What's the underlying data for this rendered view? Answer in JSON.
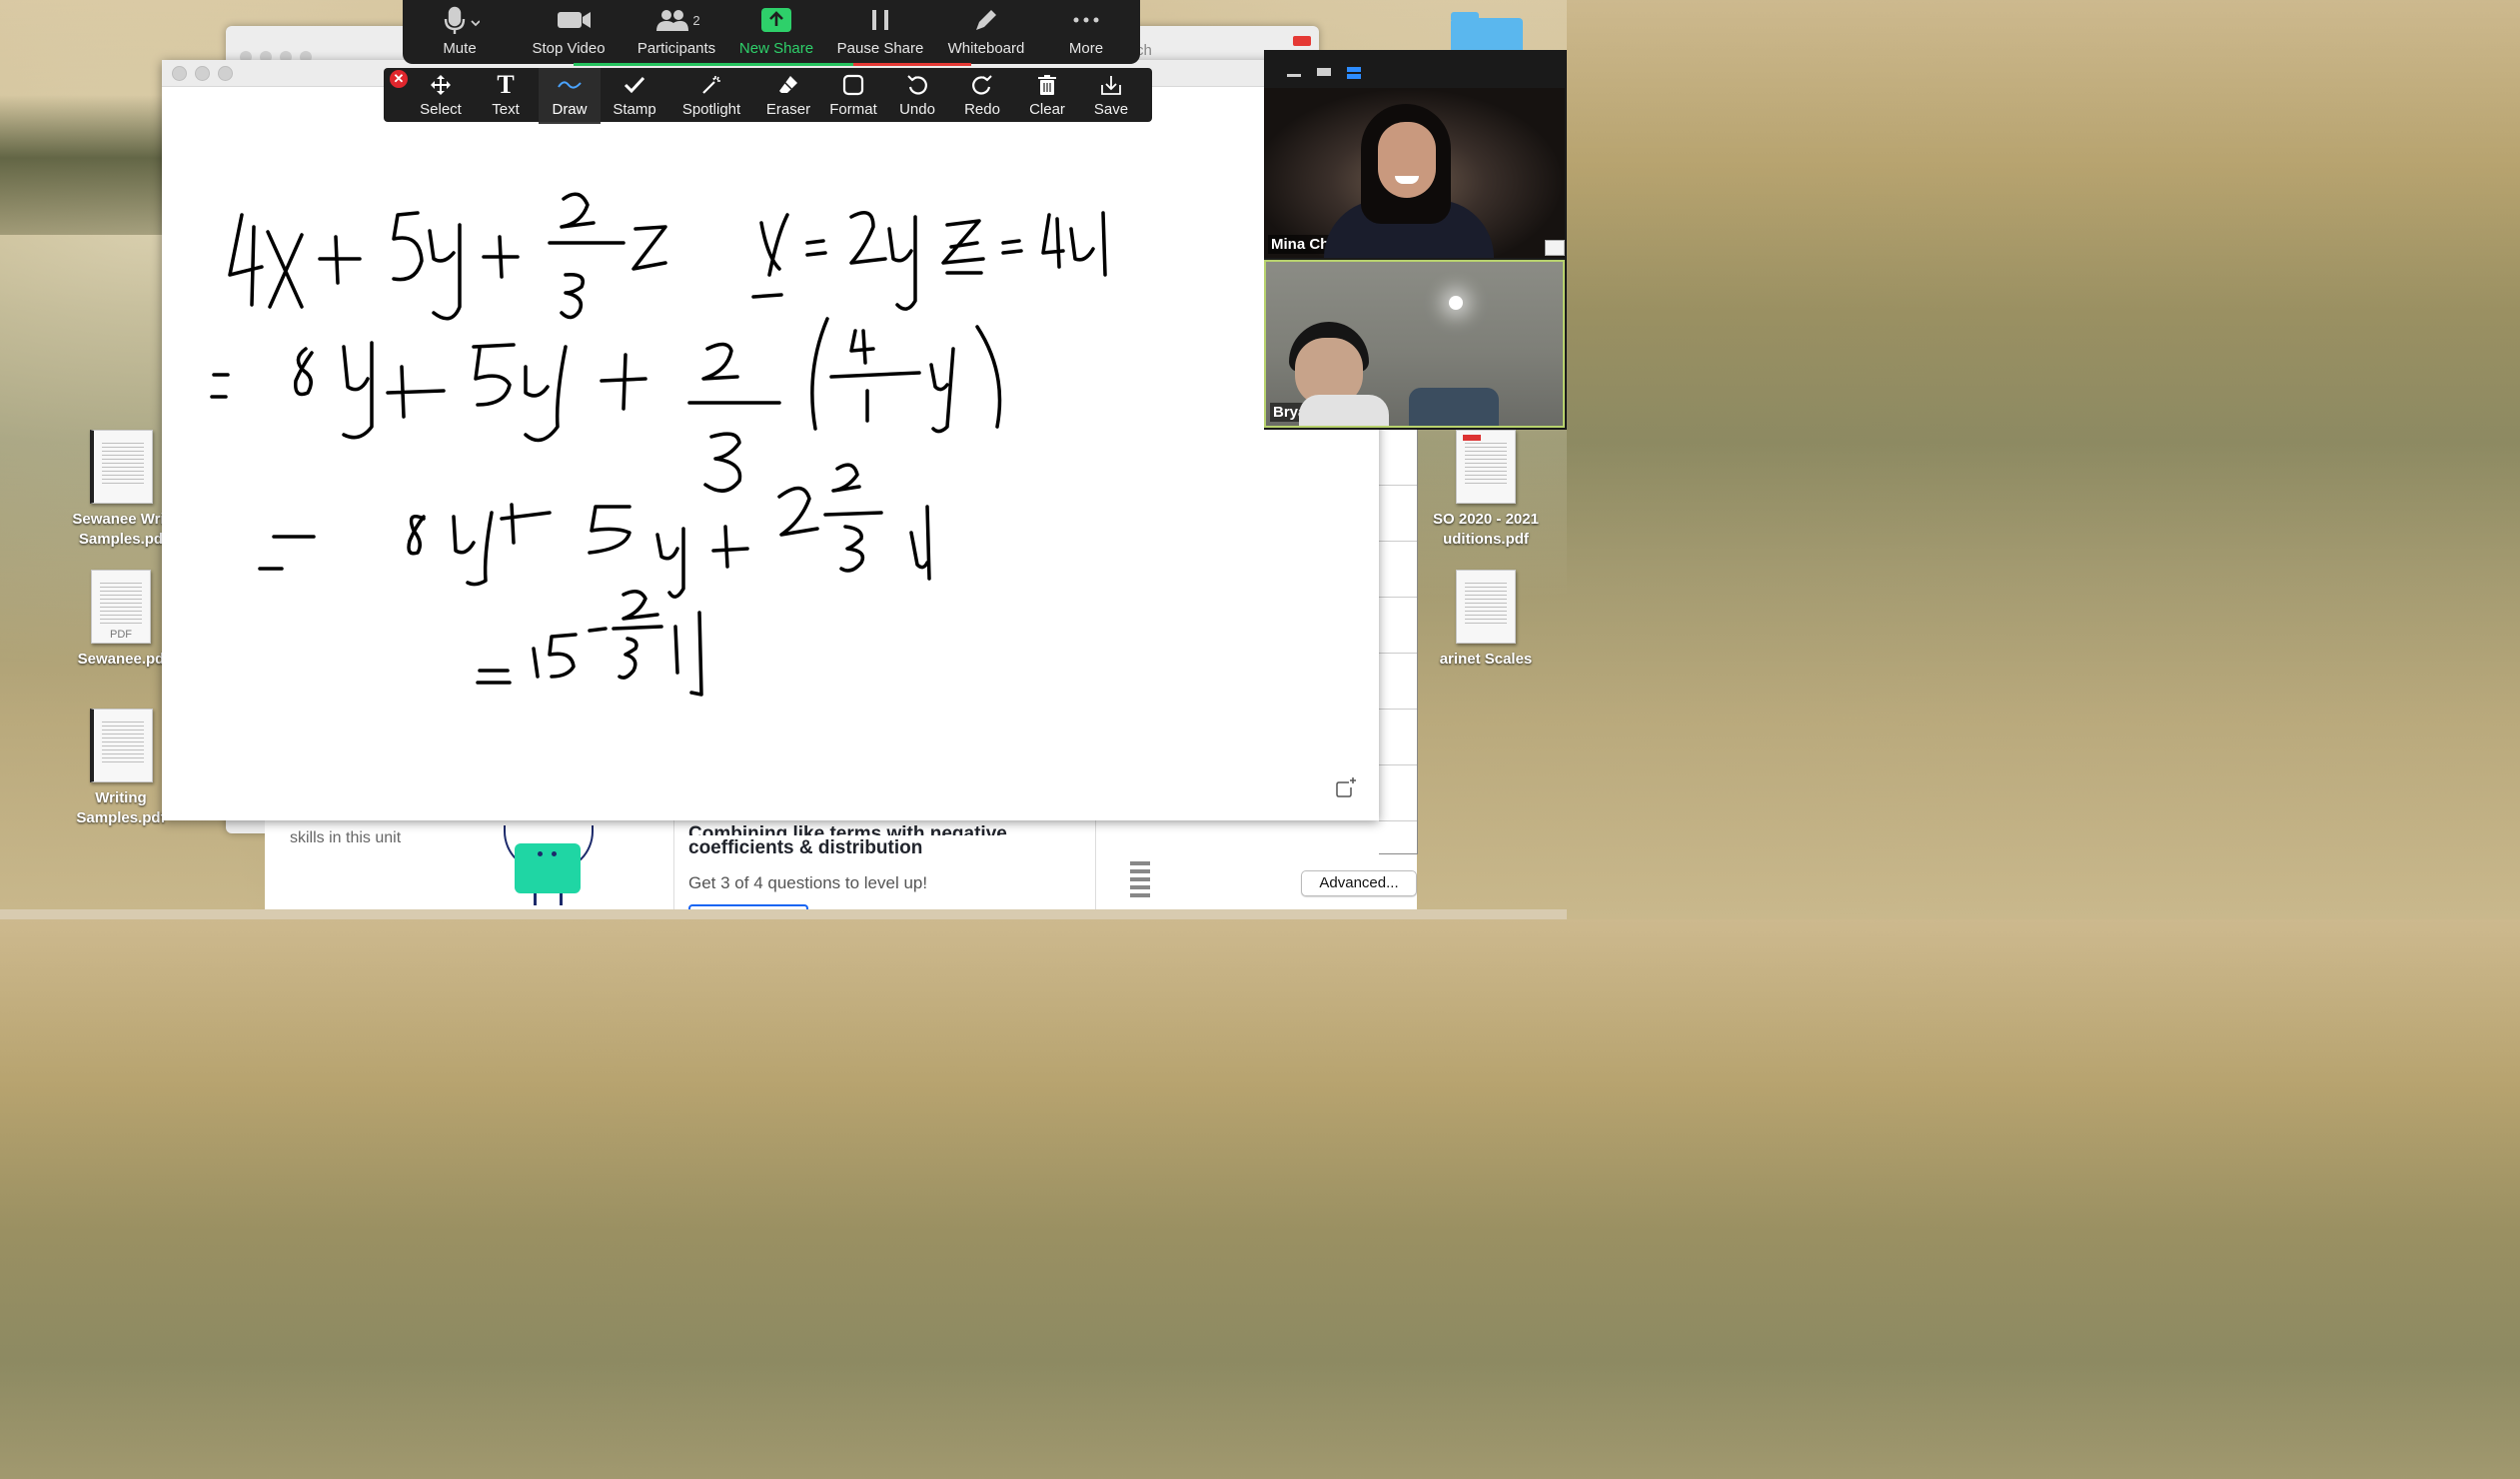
{
  "zoom_toolbar": {
    "mute": "Mute",
    "stop_video": "Stop Video",
    "participants": "Participants",
    "participants_count": "2",
    "new_share": "New Share",
    "pause_share": "Pause Share",
    "whiteboard": "Whiteboard",
    "more": "More"
  },
  "annotation_toolbar": {
    "select": "Select",
    "text": "Text",
    "draw": "Draw",
    "stamp": "Stamp",
    "spotlight": "Spotlight",
    "eraser": "Eraser",
    "format": "Format",
    "undo": "Undo",
    "redo": "Redo",
    "clear": "Clear",
    "save": "Save",
    "selected_tool": "Draw"
  },
  "participants": [
    {
      "name": "Mina Chae"
    },
    {
      "name": "Bryan Kim"
    }
  ],
  "desktop_icons": {
    "left": [
      {
        "label": "Sewanee Writ\nSamples.pd",
        "line1": "Sewanee Writ",
        "line2": "Samples.pd"
      },
      {
        "label": "Sewanee.pd",
        "line1": "Sewanee.pd",
        "pdf_tag": "PDF"
      },
      {
        "label": "Writing Samples.pdf",
        "line1": "Writing",
        "line2": "Samples.pdf"
      }
    ],
    "right": [
      {
        "line1": "SO 2020 - 2021",
        "line2": "uditions.pdf"
      },
      {
        "line1": "arinet Scales"
      }
    ]
  },
  "background_window": {
    "search_partial": "rch",
    "skills_text": "skills in this unit",
    "exercise_title_partial": "Combining like terms with negative",
    "exercise_title": "coefficients & distribution",
    "exercise_sub": "Get 3 of 4 questions to level up!",
    "advanced_button": "Advanced..."
  },
  "colors": {
    "toolbar_bg": "#1f1f1f",
    "share_green": "#2ed06a",
    "close_red": "#e0262d",
    "active_speaker_border": "#b8d26e"
  },
  "icons": {
    "mute": "microphone-icon",
    "stop_video": "camera-icon",
    "participants": "people-icon",
    "new_share": "share-up-arrow-icon",
    "pause_share": "pause-icon",
    "whiteboard": "pencil-icon",
    "more": "ellipsis-icon"
  }
}
